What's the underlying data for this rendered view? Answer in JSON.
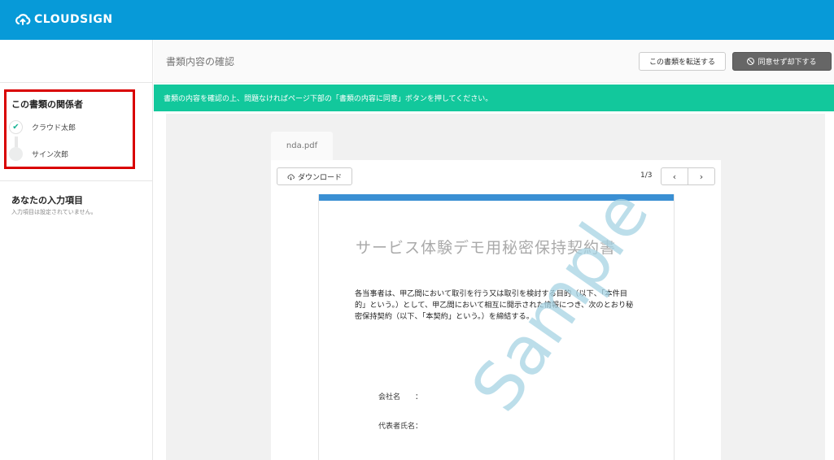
{
  "brand": {
    "name": "CLOUDSIGN",
    "icon": "cloud-up-icon",
    "color": "#079ad8"
  },
  "header": {
    "title": "書類内容の確認",
    "forward_button": "この書類を転送する",
    "decline_button": "同意せず却下する",
    "decline_icon": "ban-icon"
  },
  "sidebar": {
    "parties_title": "この書類の関係者",
    "parties": [
      {
        "name": "クラウド太郎",
        "status": "signed"
      },
      {
        "name": "サイン次郎",
        "status": "pending"
      }
    ],
    "inputs_title": "あなたの入力項目",
    "inputs_desc": "入力項目は設定されていません。"
  },
  "notice": {
    "text": "書類の内容を確認の上、問題なければページ下部の「書類の内容に同意」ボタンを押してください。",
    "color": "#12c89c"
  },
  "viewer": {
    "file_tab": "nda.pdf",
    "download_button": "ダウンロード",
    "page_indicator": "1/3",
    "prev_icon": "chevron-left-icon",
    "next_icon": "chevron-right-icon"
  },
  "document": {
    "title": "サービス体験デモ用秘密保持契約書",
    "body": "各当事者は、甲乙間において取引を行う又は取引を検討する目的（以下、「本件目的」という。）として、甲乙間において相互に開示された情報につき、次のとおり秘密保持契約（以下、「本契約」という。）を締結する。",
    "watermark": "Sample",
    "field_company": "会社名　　：",
    "field_representative": "代表者氏名："
  }
}
